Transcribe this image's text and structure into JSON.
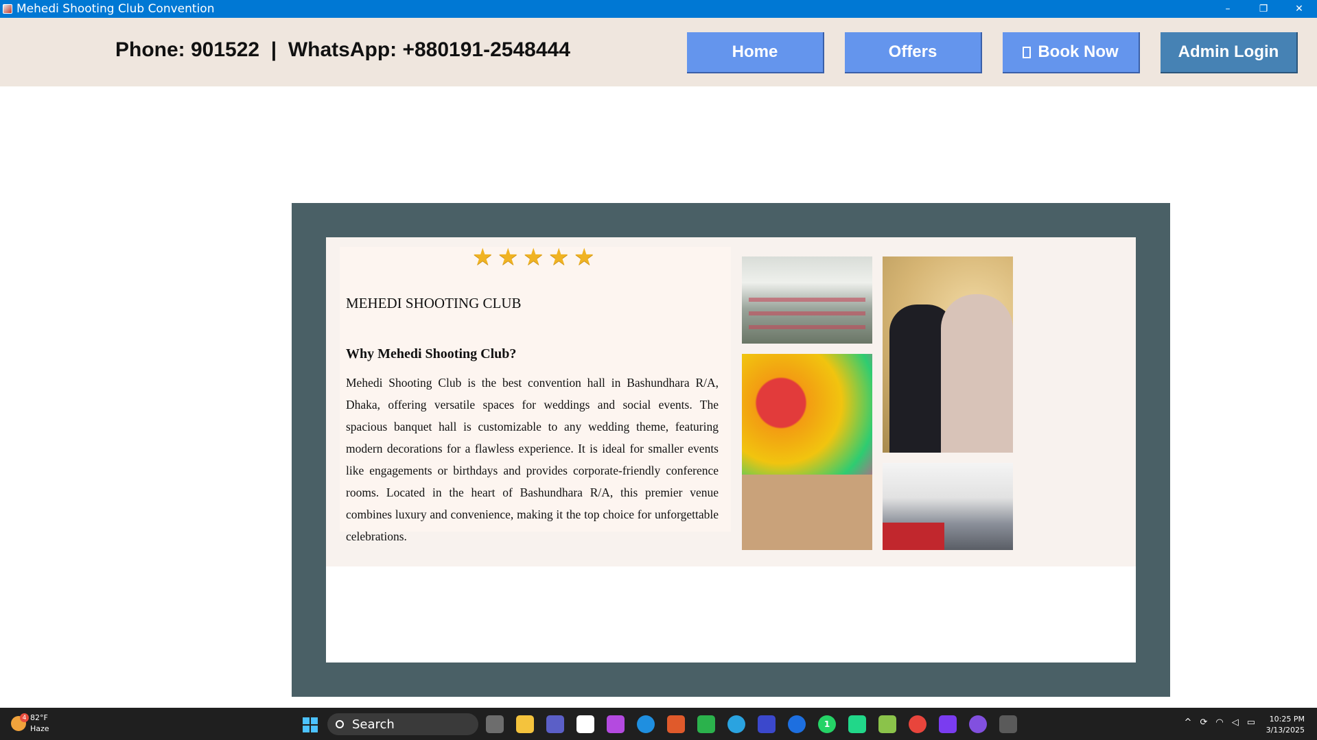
{
  "window": {
    "title": "Mehedi Shooting Club Convention",
    "controls": {
      "minimize": "–",
      "restore": "❐",
      "close": "✕"
    }
  },
  "header": {
    "contact": "Phone: 901522  |  WhatsApp: +880191-2548444",
    "nav": {
      "home": "Home",
      "offers": "Offers",
      "book_now": "Book Now",
      "admin_login": "Admin Login"
    },
    "colors": {
      "nav_button": "#6495ed",
      "admin_button": "#4682b4",
      "header_bg": "#efe6de"
    }
  },
  "main": {
    "rating_stars": 5,
    "star_glyph": "★",
    "club_name": "MEHEDI SHOOTING CLUB",
    "why_heading": "Why Mehedi Shooting Club?",
    "description": "Mehedi Shooting Club is the best convention hall in Bashundhara R/A, Dhaka, offering versatile spaces for weddings and social events. The spacious banquet hall is customizable to any wedding theme, featuring modern decorations for a flawless experience. It is ideal for smaller events like engagements or birthdays and provides corporate-friendly conference rooms. Located in the heart of Bashundhara R/A, this premier venue combines luxury and convenience, making it the top choice for unforgettable celebrations.",
    "photos": [
      "banquet-hall-photo",
      "wedding-couple-photo",
      "holud-couple-photo",
      "seminar-hall-photo"
    ],
    "colors": {
      "outer_panel": "#4a6066",
      "card_bg": "#f8f2ee",
      "star": "#f0b323"
    }
  },
  "taskbar": {
    "weather": {
      "temp": "82°F",
      "condition": "Haze",
      "badge": "4"
    },
    "search_label": "Search",
    "whatsapp_badge": "1",
    "clock": {
      "time": "10:25 PM",
      "date": "3/13/2025"
    }
  }
}
